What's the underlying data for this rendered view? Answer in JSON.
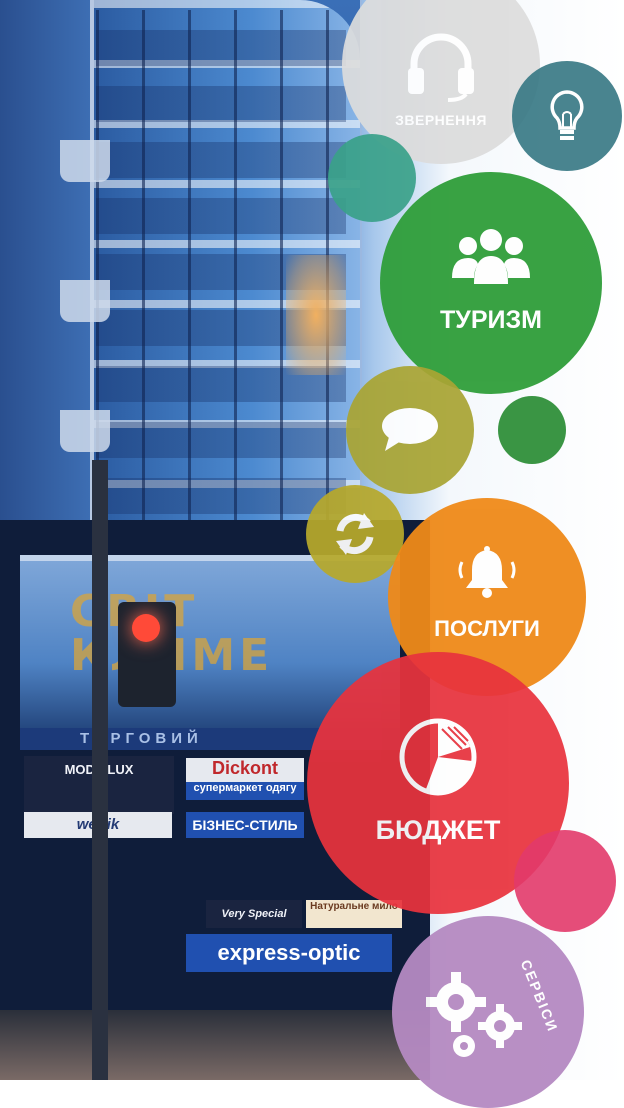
{
  "background": {
    "mall_sign": "СВІТ\nКЛИМЕ",
    "mall_band": "ТОРГОВИЙ",
    "shops": [
      "MODA LUX",
      "Dickont",
      "супермаркет одягу",
      "БІЗНЕС-СТИЛЬ",
      "wettik",
      "express-optic",
      "Натуральне мило",
      "Very Special"
    ]
  },
  "menu": {
    "zvernennia": {
      "label": "ЗВЕРНЕННЯ",
      "icon": "headset-icon",
      "color": "#dcdcdc"
    },
    "ideas": {
      "icon": "lightbulb-icon",
      "color": "#3a7a86"
    },
    "turyzm": {
      "label": "ТУРИЗМ",
      "icon": "people-group-icon",
      "color": "#2f9e3a"
    },
    "chat": {
      "icon": "chat-bubble-icon",
      "color": "#a9a534"
    },
    "refresh": {
      "icon": "refresh-icon",
      "color": "#b7a92c"
    },
    "posluhy": {
      "label": "ПОСЛУГИ",
      "icon": "bell-icon",
      "color": "#ef8a19"
    },
    "biudzhet": {
      "label": "БЮДЖЕТ",
      "icon": "pie-chart-icon",
      "color": "#e8333d"
    },
    "servisy": {
      "label": "СЕРВІСИ",
      "icon": "gears-icon",
      "color": "#b58ac2"
    }
  },
  "decor_colors": {
    "teal": "#3aa189",
    "green": "#2f8f3a",
    "pink": "#e23a6a"
  }
}
